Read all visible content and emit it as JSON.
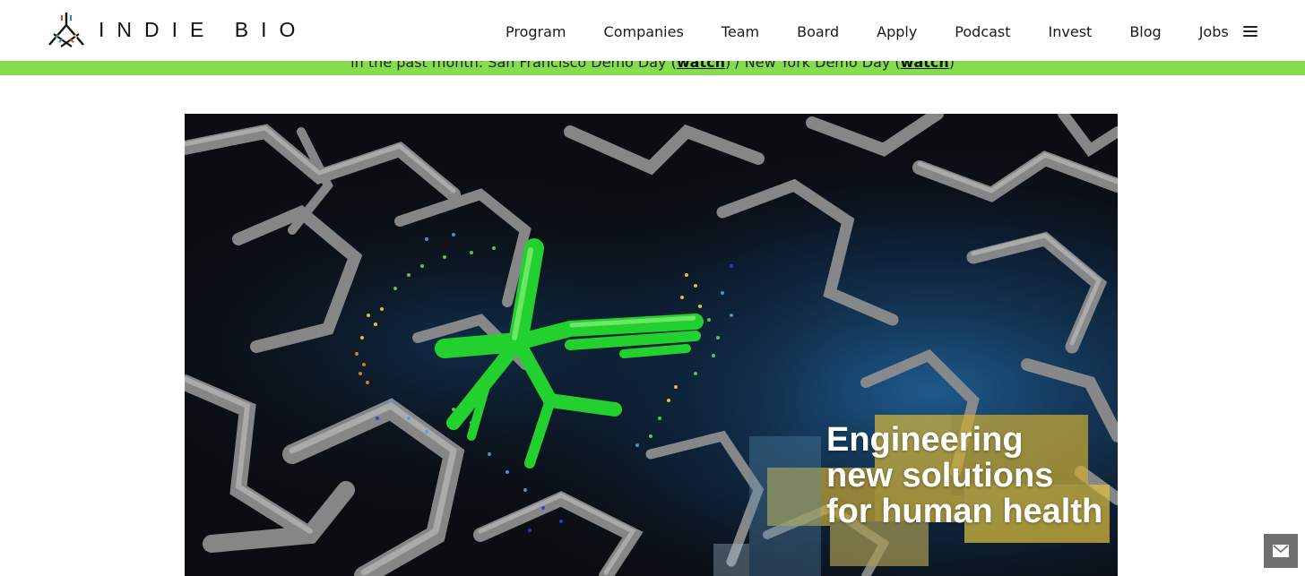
{
  "brand": {
    "name": "INDIE BIO"
  },
  "nav": {
    "items": [
      {
        "label": "Program"
      },
      {
        "label": "Companies"
      },
      {
        "label": "Team"
      },
      {
        "label": "Board"
      },
      {
        "label": "Apply"
      },
      {
        "label": "Podcast"
      },
      {
        "label": "Invest"
      },
      {
        "label": "Blog"
      },
      {
        "label": "Jobs"
      }
    ],
    "menu_icon": "hamburger-icon"
  },
  "announcement": {
    "prefix": "In the past month: San Francisco Demo Day (",
    "link1": "watch",
    "middle": ") / New York Demo Day (",
    "link2": "watch",
    "suffix": ")"
  },
  "hero": {
    "line1": "Engineering",
    "line2": "new solutions",
    "line3": "for human health"
  },
  "contact": {
    "icon": "envelope-icon"
  },
  "colors": {
    "announcement_bg": "#86dc4e",
    "molecule_green": "#22d12e",
    "highlight_yellow": "#d8b93a"
  }
}
